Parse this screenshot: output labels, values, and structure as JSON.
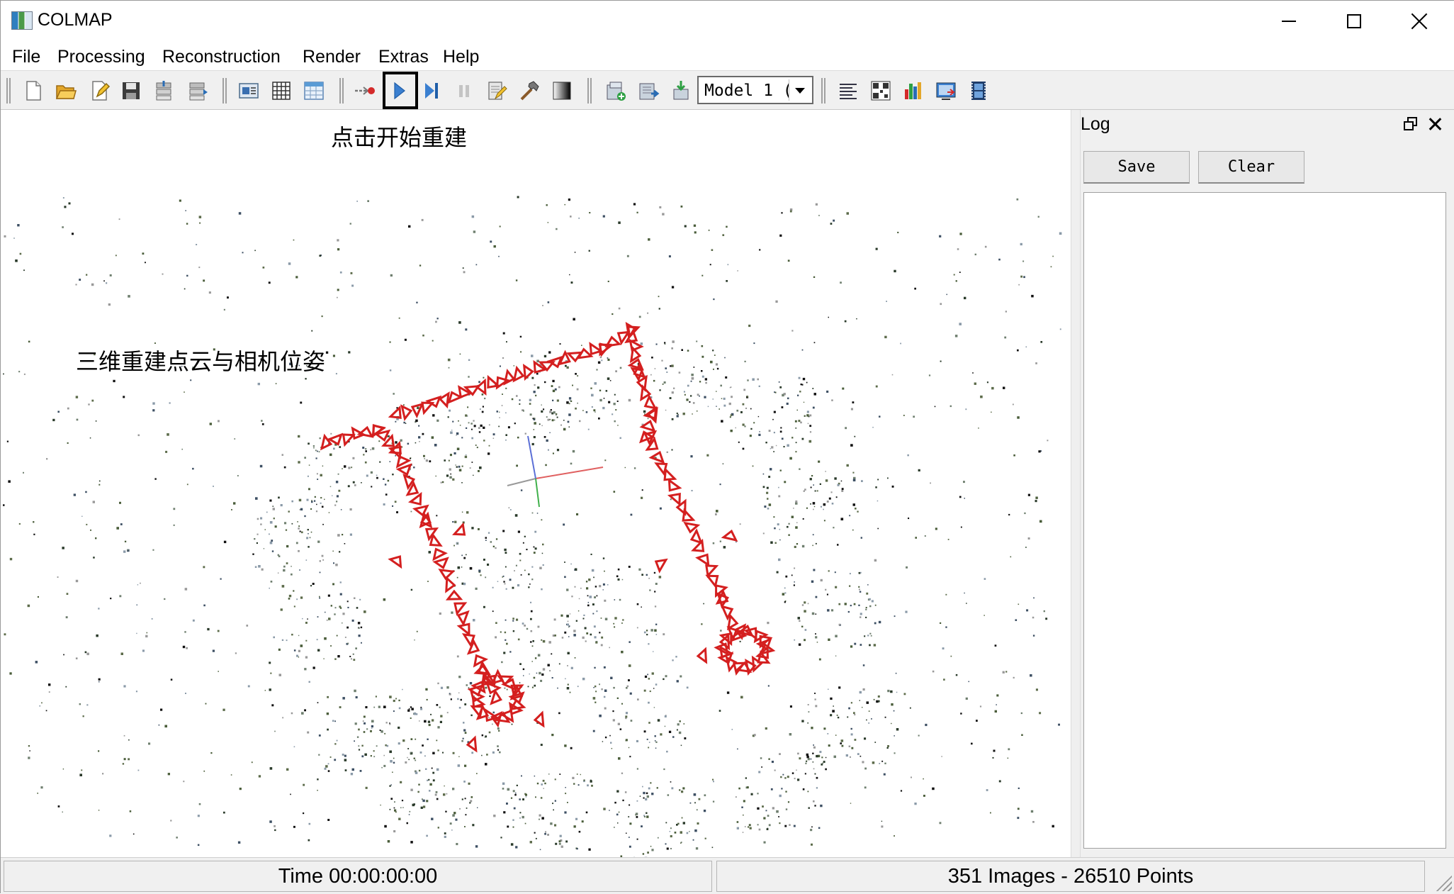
{
  "window": {
    "title": "COLMAP"
  },
  "menu": [
    "File",
    "Processing",
    "Reconstruction",
    "Render",
    "Extras",
    "Help"
  ],
  "toolbar": {
    "icons": [
      "new-project-icon",
      "open-project-icon",
      "edit-project-icon",
      "save-project-icon",
      "import-icon",
      "export-icon",
      "feature-extraction-icon",
      "feature-matching-icon",
      "database-management-icon",
      "automatic-reconstruction-icon",
      "start-reconstruction-icon",
      "step-reconstruction-icon",
      "pause-reconstruction-icon",
      "reconstruction-options-icon",
      "bundle-adjustment-icon",
      "dense-reconstruction-icon",
      "add-model-icon",
      "export-model-icon",
      "import-model-icon",
      "log-icon",
      "match-matrix-icon",
      "statistics-icon",
      "render-options-icon",
      "render-movie-icon"
    ],
    "model_select": "Model 1 (",
    "highlight_color": "#000000"
  },
  "viewport": {
    "annotation_run": "点击开始重建",
    "annotation_cloud": "三维重建点云与相机位姿",
    "camera_color": "#d41f1f",
    "point_colors": [
      "#111111",
      "#2a3a2a",
      "#4a5d3a",
      "#6f7f6f",
      "#8a9aa8",
      "#3d4f63",
      "#5c6b4a",
      "#999999"
    ]
  },
  "log": {
    "title": "Log",
    "save_label": "Save",
    "clear_label": "Clear"
  },
  "status": {
    "time": "Time 00:00:00:00",
    "summary": "351 Images - 26510 Points"
  }
}
